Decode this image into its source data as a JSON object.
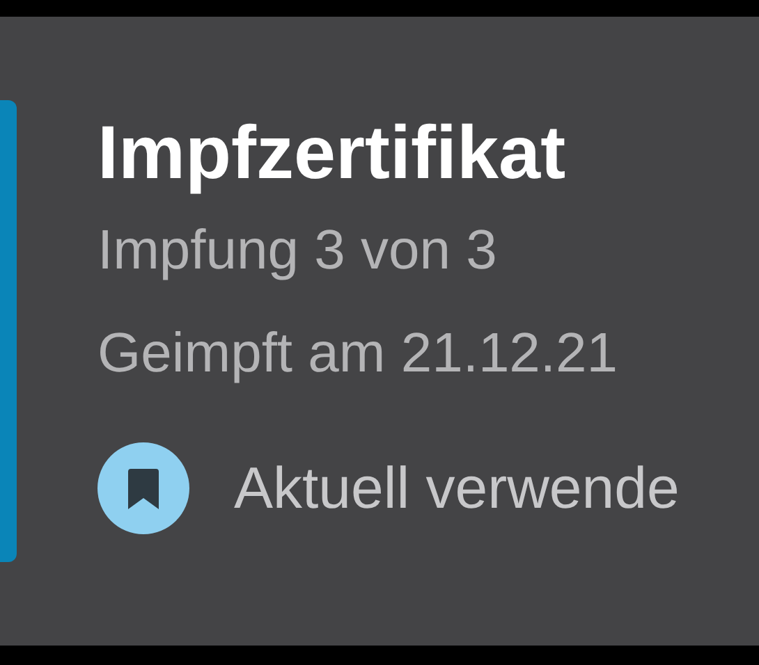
{
  "card": {
    "title": "Impfzertifikat",
    "dose": "Impfung 3 von 3",
    "date": "Geimpft am 21.12.21",
    "status": {
      "label": "Aktuell verwende",
      "active": true
    }
  }
}
